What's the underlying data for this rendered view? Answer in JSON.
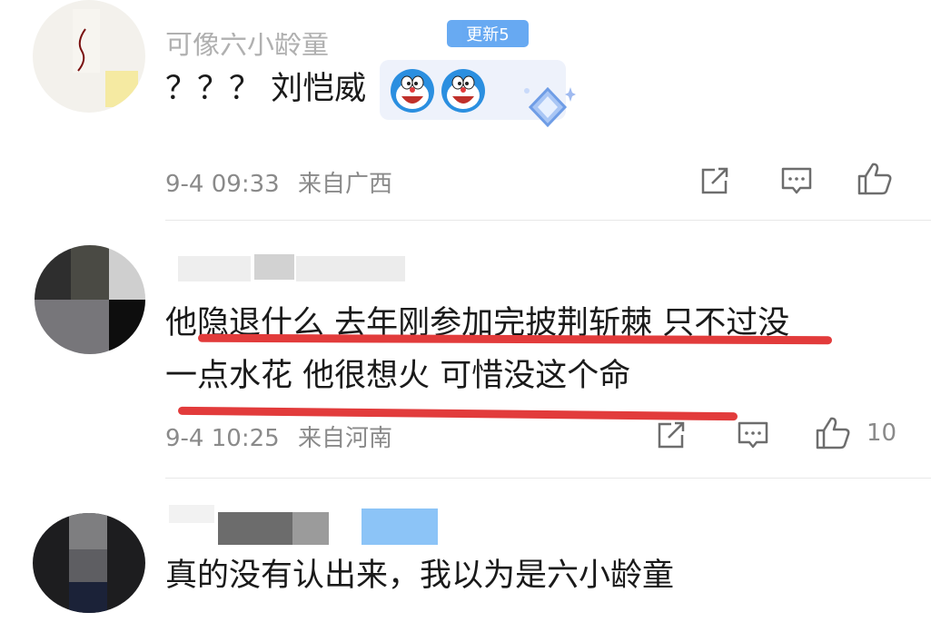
{
  "comments": [
    {
      "prev_text_fragment": "可像六小龄童",
      "badge": "更新5",
      "text": "？？？ 刘恺威",
      "time": "9-4 09:33",
      "location": "来自广西"
    },
    {
      "text_line1": "他隐退什么 去年刚参加完披荆斩棘 只不过没",
      "text_line2": "一点水花 他很想火 可惜没这个命",
      "time": "9-4 10:25",
      "location": "来自河南",
      "likes": "10"
    },
    {
      "text": "真的没有认出来，我以为是六小龄童"
    }
  ],
  "colors": {
    "underline": "#e23b3b",
    "meta_gray": "#8a8a8a",
    "icon_gray": "#6d6d6d"
  }
}
